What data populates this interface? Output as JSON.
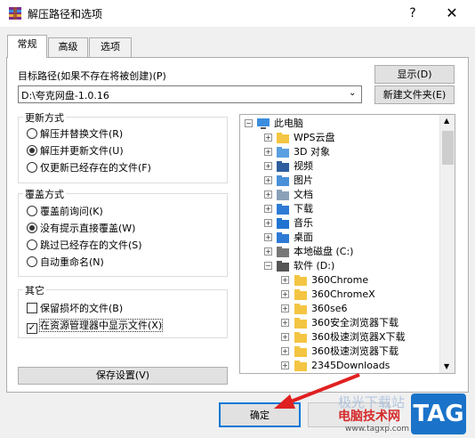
{
  "window": {
    "title": "解压路径和选项",
    "help": "?",
    "close": "✕"
  },
  "tabs": [
    {
      "label": "常规"
    },
    {
      "label": "高级"
    },
    {
      "label": "选项"
    }
  ],
  "dest": {
    "label": "目标路径(如果不存在将被创建)(P)",
    "value": "D:\\夸克网盘-1.0.16",
    "show_button": "显示(D)",
    "new_folder_button": "新建文件夹(E)"
  },
  "update_mode": {
    "title": "更新方式",
    "options": [
      "解压并替换文件(R)",
      "解压并更新文件(U)",
      "仅更新已经存在的文件(F)"
    ],
    "selected": 1
  },
  "overwrite_mode": {
    "title": "覆盖方式",
    "options": [
      "覆盖前询问(K)",
      "没有提示直接覆盖(W)",
      "跳过已经存在的文件(S)",
      "自动重命名(N)"
    ],
    "selected": 1
  },
  "misc": {
    "title": "其它",
    "options": [
      {
        "label": "保留损坏的文件(B)",
        "checked": false
      },
      {
        "label": "在资源管理器中显示文件(X)",
        "checked": true
      }
    ]
  },
  "save_button": "保存设置(V)",
  "tree": {
    "root": "此电脑",
    "items": [
      "WPS云盘",
      "3D 对象",
      "视频",
      "图片",
      "文档",
      "下载",
      "音乐",
      "桌面",
      "本地磁盘 (C:)",
      "软件 (D:)"
    ],
    "subitems": [
      "360Chrome",
      "360ChromeX",
      "360se6",
      "360安全浏览器下载",
      "360极速浏览器X下载",
      "360极速浏览器下载",
      "2345Downloads"
    ]
  },
  "footer": {
    "ok_button": "确定"
  },
  "watermark": {
    "text": "电脑技术网",
    "tag": "TAG",
    "url": "www.tagxp.com",
    "faded": "极光下载站"
  },
  "colors": {
    "accent": "#0078d7",
    "arrow": "#e02020",
    "folder": "#f4c542"
  }
}
